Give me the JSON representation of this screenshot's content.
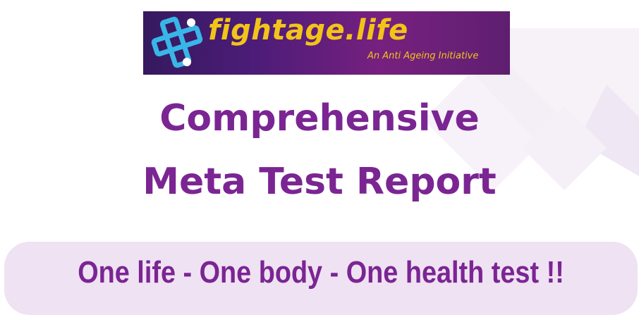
{
  "brand": {
    "name": "fightage.life",
    "tagline": "An Anti Ageing Initiative",
    "colors": {
      "banner_bg": "#4c1c78",
      "brand_yellow": "#f2c418",
      "logo_cyan": "#39b6e8"
    }
  },
  "heading": {
    "line1": "Comprehensive",
    "line2": "Meta Test Report",
    "color": "#7b2593"
  },
  "slogan": {
    "text": "One life - One body - One health test !!",
    "box_color": "#efe2f3"
  },
  "icons": {
    "logo": "cross-people-logo-icon"
  }
}
